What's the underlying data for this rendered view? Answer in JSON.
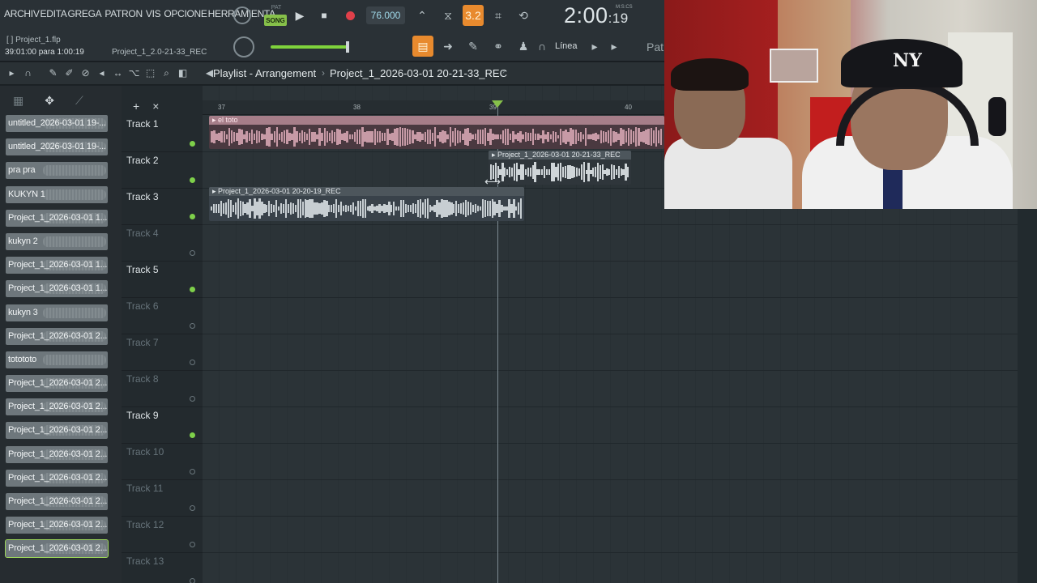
{
  "menu": {
    "items": [
      "ARCHIV",
      "EDITA",
      "GREGA",
      "PATRON",
      "VIS",
      "OPCIONE",
      "HERRAMIENTA"
    ]
  },
  "hint": {
    "filename": "[  ] Project_1.flp",
    "time": "39:01:00 para 1:00:19",
    "clip": "Project_1_2.0-21-33_REC"
  },
  "transport": {
    "pat_label": "PAT",
    "song_label": "SONG",
    "tempo": "76.000",
    "pattern_num": "3.2",
    "time_main": "2:00",
    "time_sub": ":19",
    "time_unit": "M:S:CS",
    "snap": "Línea",
    "pattern_btn": "Patr",
    "master_volume_fraction": 0.95
  },
  "playlist": {
    "title": "Playlist - Arrangement",
    "separator": "›",
    "project": "Project_1_2026-03-01 20-21-33_REC",
    "arrow": "›"
  },
  "browser": {
    "clips": [
      "untitled_2026-03-01 19-...",
      "untitled_2026-03-01 19-...",
      "pra pra",
      "KUKYN 1",
      "Project_1_2026-03-01 1...",
      "kukyn 2",
      "Project_1_2026-03-01 1...",
      "Project_1_2026-03-01 1...",
      "kukyn 3",
      "Project_1_2026-03-01 2...",
      "totototo",
      "Project_1_2026-03-01 2...",
      "Project_1_2026-03-01 2...",
      "Project_1_2026-03-01 2...",
      "Project_1_2026-03-01 2...",
      "Project_1_2026-03-01 2...",
      "Project_1_2026-03-01 2...",
      "Project_1_2026-03-01 2...",
      "Project_1_2026-03-01 2..."
    ]
  },
  "tracks": [
    "Track 1",
    "Track 2",
    "Track 3",
    "Track 4",
    "Track 5",
    "Track 6",
    "Track 7",
    "Track 8",
    "Track 9",
    "Track 10",
    "Track 11",
    "Track 12",
    "Track 13"
  ],
  "ruler": {
    "ticks": [
      "37",
      "38",
      "39",
      "40"
    ]
  },
  "clips": {
    "c1": "el toto",
    "c2": "Project_1_2026-03-01 20-21-33_REC",
    "c3": "Project_1_2026-03-01 20-20-19_REC"
  },
  "webcam": {
    "cap_logo": "NY"
  }
}
